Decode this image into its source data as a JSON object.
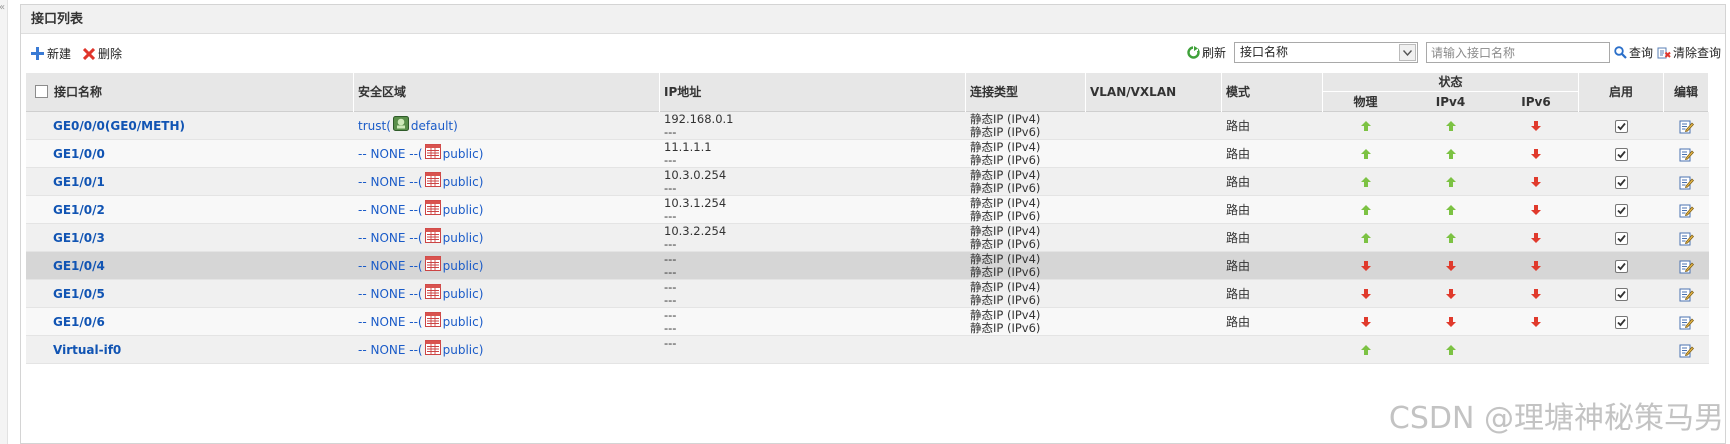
{
  "panel": {
    "title": "接口列表"
  },
  "toolbar": {
    "new_label": "新建",
    "delete_label": "删除",
    "refresh_label": "刷新",
    "filter_select_value": "接口名称",
    "search_placeholder": "请输入接口名称",
    "query_label": "查询",
    "clear_label": "清除查询"
  },
  "columns": {
    "name": "接口名称",
    "zone": "安全区域",
    "ip": "IP地址",
    "conn": "连接类型",
    "vlan": "VLAN/VXLAN",
    "mode": "模式",
    "status": "状态",
    "status_physical": "物理",
    "status_ipv4": "IPv4",
    "status_ipv6": "IPv6",
    "enable": "启用",
    "edit": "编辑"
  },
  "colors": {
    "up": "#7cc243",
    "down": "#e03a2c",
    "link": "#1154b3"
  },
  "rows": [
    {
      "name": "GE0/0/0(GE0/METH)",
      "zone_prefix": "trust(",
      "zone_icon": "zone-trust-icon",
      "zone_suffix": " default)",
      "ip1": "192.168.0.1",
      "ip2": "---",
      "conn1": "静态IP (IPv4)",
      "conn2": "静态IP (IPv6)",
      "mode": "路由",
      "physical": "up",
      "ipv4": "up",
      "ipv6": "down",
      "enabled": true
    },
    {
      "name": "GE1/0/0",
      "zone_prefix": "-- NONE --(",
      "zone_icon": "zone-public-icon",
      "zone_suffix": " public)",
      "ip1": "11.1.1.1",
      "ip2": "---",
      "conn1": "静态IP (IPv4)",
      "conn2": "静态IP (IPv6)",
      "mode": "路由",
      "physical": "up",
      "ipv4": "up",
      "ipv6": "down",
      "enabled": true
    },
    {
      "name": "GE1/0/1",
      "zone_prefix": "-- NONE --(",
      "zone_icon": "zone-public-icon",
      "zone_suffix": " public)",
      "ip1": "10.3.0.254",
      "ip2": "---",
      "conn1": "静态IP (IPv4)",
      "conn2": "静态IP (IPv6)",
      "mode": "路由",
      "physical": "up",
      "ipv4": "up",
      "ipv6": "down",
      "enabled": true
    },
    {
      "name": "GE1/0/2",
      "zone_prefix": "-- NONE --(",
      "zone_icon": "zone-public-icon",
      "zone_suffix": " public)",
      "ip1": "10.3.1.254",
      "ip2": "---",
      "conn1": "静态IP (IPv4)",
      "conn2": "静态IP (IPv6)",
      "mode": "路由",
      "physical": "up",
      "ipv4": "up",
      "ipv6": "down",
      "enabled": true
    },
    {
      "name": "GE1/0/3",
      "zone_prefix": "-- NONE --(",
      "zone_icon": "zone-public-icon",
      "zone_suffix": " public)",
      "ip1": "10.3.2.254",
      "ip2": "---",
      "conn1": "静态IP (IPv4)",
      "conn2": "静态IP (IPv6)",
      "mode": "路由",
      "physical": "up",
      "ipv4": "up",
      "ipv6": "down",
      "enabled": true
    },
    {
      "name": "GE1/0/4",
      "zone_prefix": "-- NONE --(",
      "zone_icon": "zone-public-icon",
      "zone_suffix": " public)",
      "ip1": "---",
      "ip2": "---",
      "conn1": "静态IP (IPv4)",
      "conn2": "静态IP (IPv6)",
      "mode": "路由",
      "physical": "down",
      "ipv4": "down",
      "ipv6": "down",
      "enabled": true,
      "selected": true
    },
    {
      "name": "GE1/0/5",
      "zone_prefix": "-- NONE --(",
      "zone_icon": "zone-public-icon",
      "zone_suffix": " public)",
      "ip1": "---",
      "ip2": "---",
      "conn1": "静态IP (IPv4)",
      "conn2": "静态IP (IPv6)",
      "mode": "路由",
      "physical": "down",
      "ipv4": "down",
      "ipv6": "down",
      "enabled": true
    },
    {
      "name": "GE1/0/6",
      "zone_prefix": "-- NONE --(",
      "zone_icon": "zone-public-icon",
      "zone_suffix": " public)",
      "ip1": "---",
      "ip2": "---",
      "conn1": "静态IP (IPv4)",
      "conn2": "静态IP (IPv6)",
      "mode": "路由",
      "physical": "down",
      "ipv4": "down",
      "ipv6": "down",
      "enabled": true
    },
    {
      "name": "Virtual-if0",
      "zone_prefix": "-- NONE --(",
      "zone_icon": "zone-public-icon",
      "zone_suffix": " public)",
      "ip1": "---",
      "ip2": "",
      "conn1": "",
      "conn2": "",
      "mode": "",
      "physical": "up",
      "ipv4": "up",
      "ipv6": "",
      "enabled": null
    }
  ],
  "watermark": "CSDN @理塘神秘策马男"
}
